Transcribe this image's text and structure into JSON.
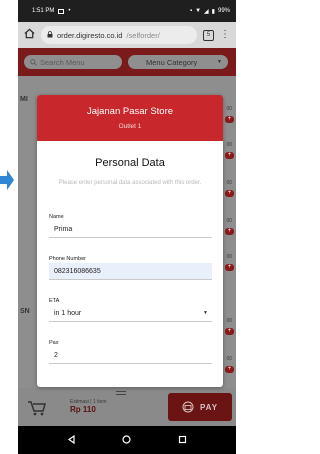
{
  "status_bar": {
    "time": "1:51 PM",
    "battery": "99%"
  },
  "browser": {
    "url_host": "order.digiresto.co.id",
    "url_path": "/selforder/",
    "tab_count": "5"
  },
  "page": {
    "search_placeholder": "Search Menu",
    "category_label": "Menu Category",
    "sections": [
      "MI",
      "SN"
    ]
  },
  "modal": {
    "store_name": "Jajanan Pasar Store",
    "outlet": "Outlet 1",
    "title": "Personal Data",
    "subtitle": "Please enter personal data associated with this order.",
    "fields": {
      "name": {
        "label": "Name",
        "value": "Prima"
      },
      "phone": {
        "label": "Phone Number",
        "value": "082316086635"
      },
      "eta": {
        "label": "ETA",
        "value": "in 1 hour"
      },
      "pax": {
        "label": "Pax",
        "value": "2"
      }
    }
  },
  "cart": {
    "estimate_label": "Estimasi | 1 item",
    "estimate_price": "Rp 110",
    "pay_label": "PAY"
  },
  "colors": {
    "header_red": "#c8272b",
    "pay_red": "#6b1414",
    "active_field": "#e8f0fb"
  }
}
